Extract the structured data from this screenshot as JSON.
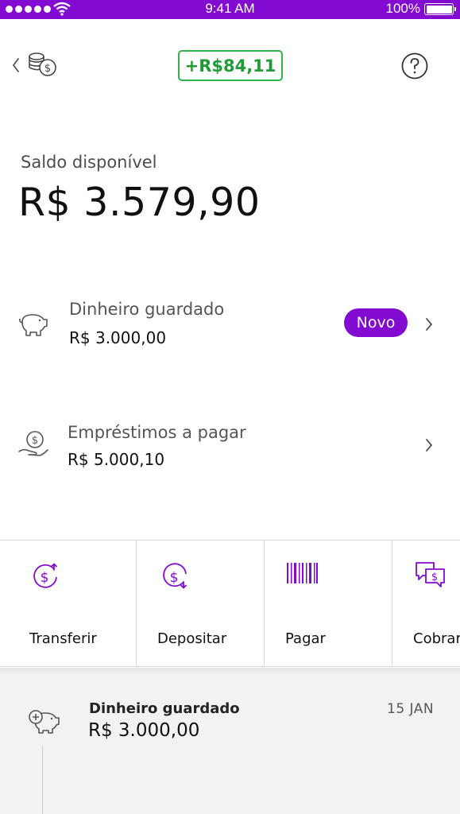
{
  "status_bar": {
    "time": "9:41 AM",
    "battery": "100%"
  },
  "header": {
    "gain_badge": "+R$84,11"
  },
  "balance": {
    "label": "Saldo disponível",
    "value": "R$ 3.579,90"
  },
  "rows": [
    {
      "title": "Dinheiro guardado",
      "value": "R$ 3.000,00",
      "badge": "Novo"
    },
    {
      "title": "Empréstimos a pagar",
      "value": "R$ 5.000,10"
    }
  ],
  "shortcuts": [
    {
      "label": "Transferir",
      "icon": "transfer-icon"
    },
    {
      "label": "Depositar",
      "icon": "deposit-icon"
    },
    {
      "label": "Pagar",
      "icon": "barcode-icon"
    },
    {
      "label": "Cobrar",
      "icon": "charge-icon"
    }
  ],
  "feed": {
    "title": "Dinheiro guardado",
    "value": "R$ 3.000,00",
    "date": "15 JAN"
  },
  "colors": {
    "brand": "#820ad1",
    "positive": "#2fb34a"
  }
}
